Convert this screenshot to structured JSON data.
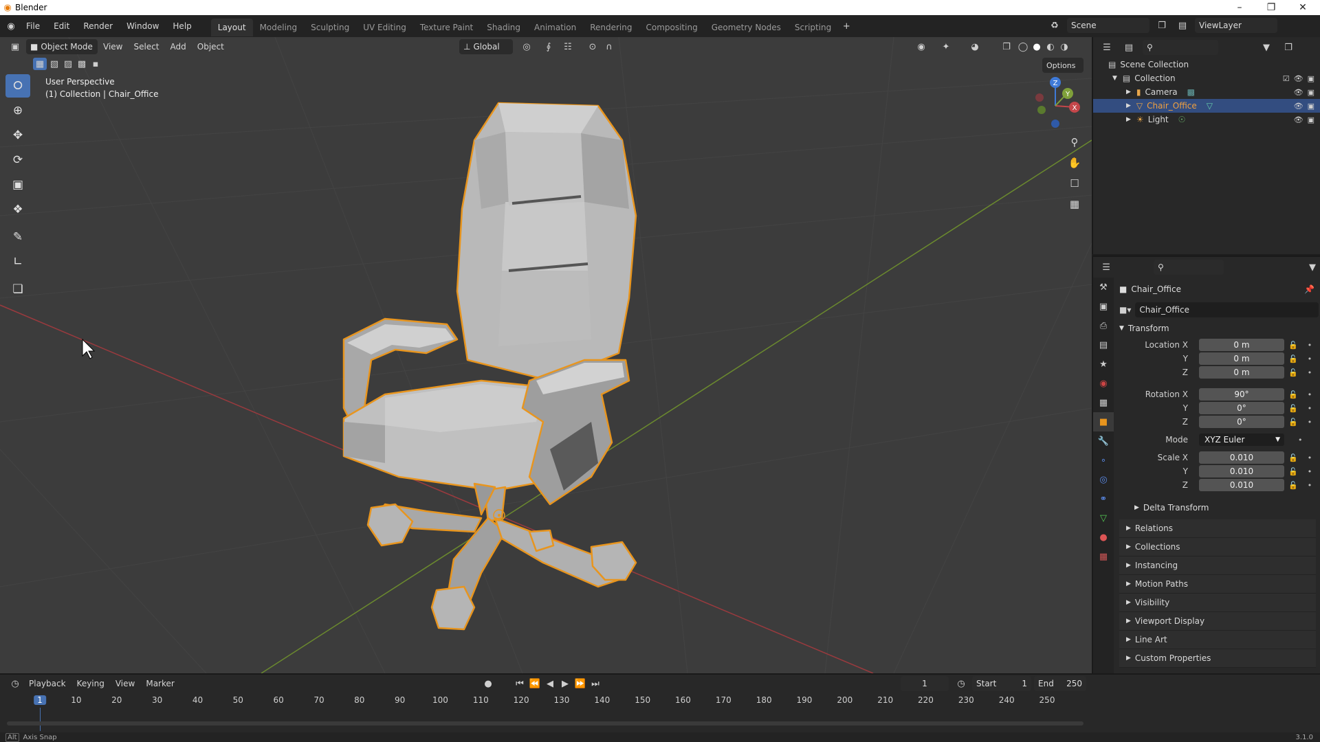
{
  "app": {
    "title": "Blender",
    "version": "3.1.0"
  },
  "menus": [
    "File",
    "Edit",
    "Render",
    "Window",
    "Help"
  ],
  "workspaces": [
    "Layout",
    "Modeling",
    "Sculpting",
    "UV Editing",
    "Texture Paint",
    "Shading",
    "Animation",
    "Rendering",
    "Compositing",
    "Geometry Nodes",
    "Scripting"
  ],
  "active_workspace": "Layout",
  "scene": {
    "name": "Scene",
    "view_layer": "ViewLayer"
  },
  "viewport": {
    "mode": "Object Mode",
    "menus": [
      "View",
      "Select",
      "Add",
      "Object"
    ],
    "orientation": "Global",
    "options_label": "Options",
    "info_line1": "User Perspective",
    "info_line2": "(1) Collection | Chair_Office"
  },
  "tools": [
    "select-box",
    "cursor",
    "move",
    "rotate",
    "scale",
    "transform",
    "annotate",
    "measure",
    "add-cube"
  ],
  "outliner": {
    "root": "Scene Collection",
    "collection": "Collection",
    "items": [
      {
        "name": "Camera",
        "icon": "camera-icon",
        "color": "#e8a64a",
        "selected": false
      },
      {
        "name": "Chair_Office",
        "icon": "mesh-icon",
        "color": "#e8a64a",
        "selected": true
      },
      {
        "name": "Light",
        "icon": "light-icon",
        "color": "#e8a64a",
        "selected": false
      }
    ]
  },
  "properties": {
    "object_name": "Chair_Office",
    "data_name": "Chair_Office",
    "transform_label": "Transform",
    "location": {
      "label": "Location X",
      "x": "0 m",
      "y": "0 m",
      "z": "0 m"
    },
    "rotation": {
      "label": "Rotation X",
      "x": "90°",
      "y": "0°",
      "z": "0°"
    },
    "mode": {
      "label": "Mode",
      "value": "XYZ Euler"
    },
    "scale": {
      "label": "Scale X",
      "x": "0.010",
      "y": "0.010",
      "z": "0.010"
    },
    "axis_labels": {
      "y": "Y",
      "z": "Z"
    },
    "delta_transform": "Delta Transform",
    "sections": [
      "Relations",
      "Collections",
      "Instancing",
      "Motion Paths",
      "Visibility",
      "Viewport Display",
      "Line Art",
      "Custom Properties"
    ]
  },
  "timeline": {
    "menus": [
      "Playback",
      "Keying",
      "View",
      "Marker"
    ],
    "current_frame": "1",
    "start_label": "Start",
    "start": "1",
    "end_label": "End",
    "end": "250",
    "ticks": [
      "1",
      "10",
      "20",
      "30",
      "40",
      "50",
      "60",
      "70",
      "80",
      "90",
      "100",
      "110",
      "120",
      "130",
      "140",
      "150",
      "160",
      "170",
      "180",
      "190",
      "200",
      "210",
      "220",
      "230",
      "240",
      "250"
    ]
  },
  "status": {
    "key": "Alt",
    "text": "Axis Snap"
  },
  "colors": {
    "accent": "#4772b3",
    "selection": "#e8a64a",
    "x_axis": "#c4464a",
    "y_axis": "#7fa03a",
    "z_axis": "#3f7ad8"
  }
}
